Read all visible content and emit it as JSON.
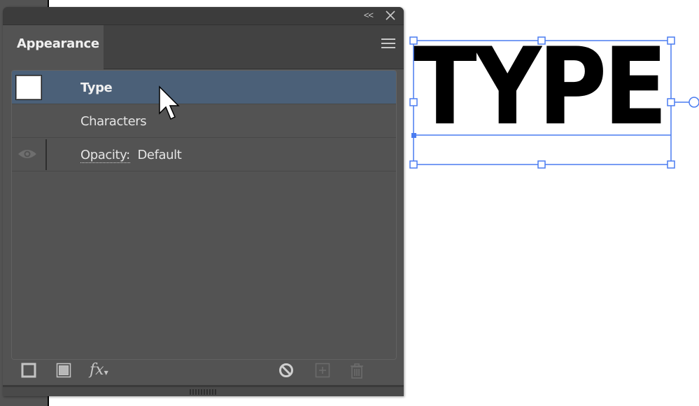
{
  "panel": {
    "tab_label": "Appearance",
    "collapse_glyph": "<<",
    "rows": [
      {
        "label": "Type",
        "selected": true,
        "has_swatch": true
      },
      {
        "label": "Characters",
        "selected": false
      },
      {
        "label_prefix": "Opacity:",
        "value": "Default",
        "has_visibility": true
      }
    ],
    "footer_icons": [
      "add-new-stroke-icon",
      "add-new-fill-icon",
      "fx-icon",
      "clear-appearance-icon",
      "duplicate-item-icon",
      "delete-item-icon"
    ],
    "fx_label": "fx"
  },
  "canvas": {
    "text": "TYPE",
    "selection_color": "#4a7cf0"
  },
  "colors": {
    "selected_row": "#4b6078",
    "panel_bg": "#535353"
  }
}
